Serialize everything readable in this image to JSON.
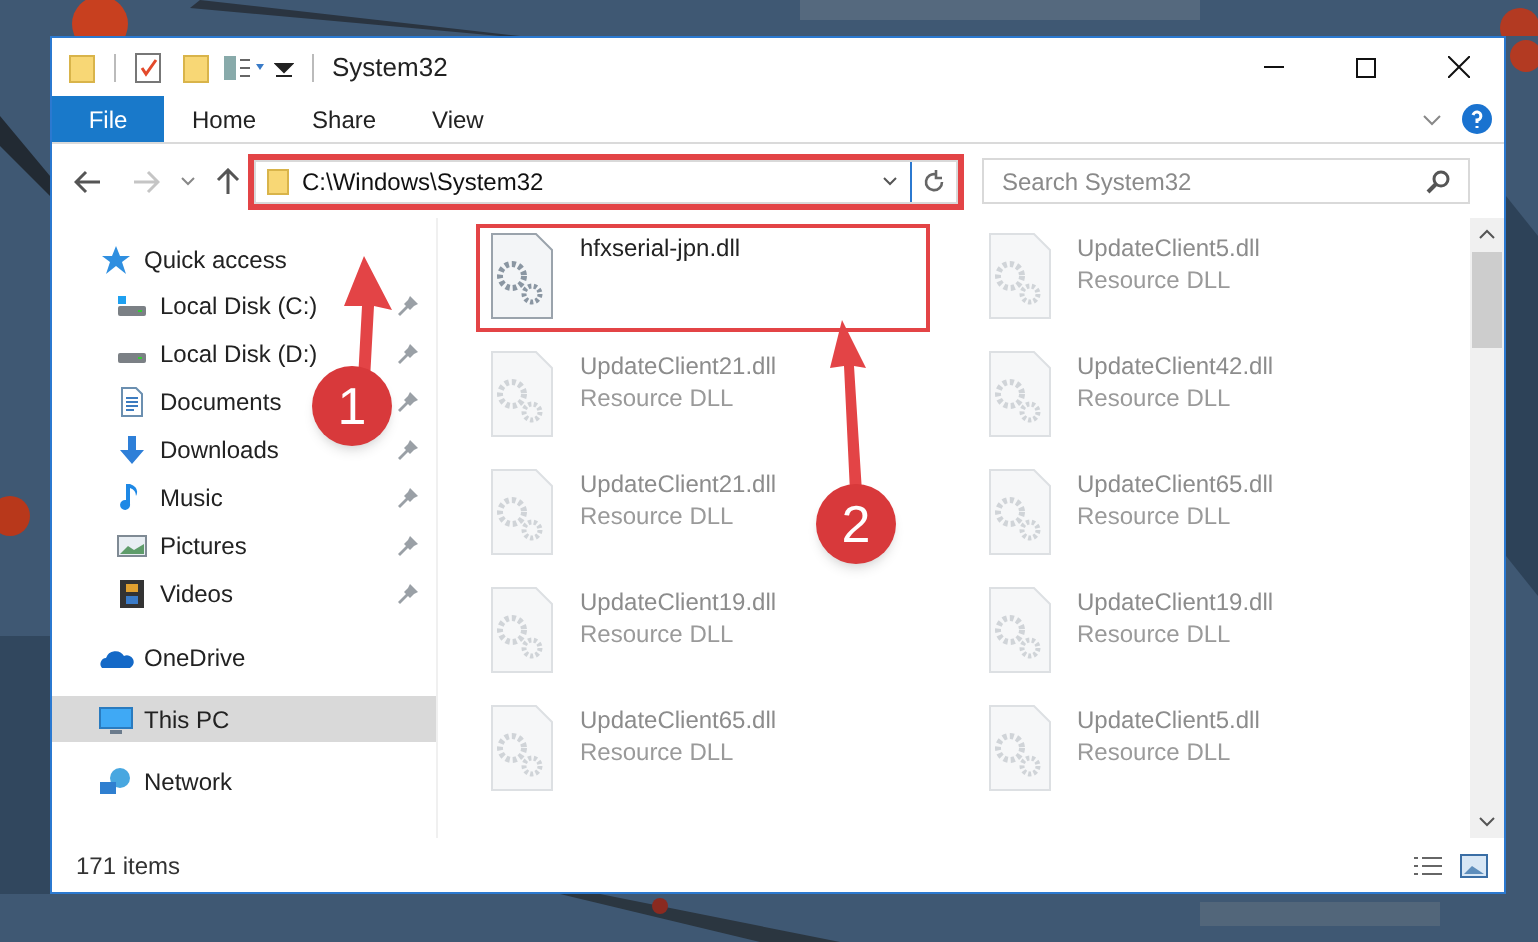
{
  "window": {
    "title": "System32"
  },
  "ribbon_tabs": [
    {
      "label": "File",
      "selected": true
    },
    {
      "label": "Home",
      "selected": false
    },
    {
      "label": "Share",
      "selected": false
    },
    {
      "label": "View",
      "selected": false
    }
  ],
  "address": {
    "value": "C:\\Windows\\System32",
    "highlighted": true
  },
  "search": {
    "placeholder": "Search System32"
  },
  "sidebar": {
    "items": [
      {
        "label": "Quick access",
        "selected": false,
        "children": [
          {
            "label": "Local Disk (C:)",
            "pinned": true
          },
          {
            "label": "Local Disk (D:)",
            "pinned": true
          },
          {
            "label": "Documents",
            "pinned": true
          },
          {
            "label": "Downloads",
            "pinned": true
          },
          {
            "label": "Music",
            "pinned": true
          },
          {
            "label": "Pictures",
            "pinned": true
          },
          {
            "label": "Videos",
            "pinned": true
          }
        ]
      },
      {
        "label": "OneDrive",
        "selected": false
      },
      {
        "label": "This PC",
        "selected": true
      },
      {
        "label": "Network",
        "selected": false
      }
    ]
  },
  "files": [
    {
      "name": "hfxserial-jpn.dll",
      "faded": false,
      "highlighted": true
    },
    {
      "name": "UpdateClient5.dll",
      "type": "Resource DLL",
      "faded": true,
      "highlighted": false
    },
    {
      "name": "UpdateClient21.dll",
      "type": "Resource DLL",
      "faded": true,
      "highlighted": false
    },
    {
      "name": "UpdateClient42.dll",
      "type": "Resource DLL",
      "faded": true,
      "highlighted": false
    },
    {
      "name": "UpdateClient21.dll",
      "type": "Resource DLL",
      "faded": true,
      "highlighted": false
    },
    {
      "name": "UpdateClient65.dll",
      "type": "Resource DLL",
      "faded": true,
      "highlighted": false
    },
    {
      "name": "UpdateClient19.dll",
      "type": "Resource DLL",
      "faded": true,
      "highlighted": false
    },
    {
      "name": "UpdateClient19.dll",
      "type": "Resource DLL",
      "faded": true,
      "highlighted": false
    },
    {
      "name": "UpdateClient65.dll",
      "type": "Resource DLL",
      "faded": true,
      "highlighted": false
    },
    {
      "name": "UpdateClient5.dll",
      "type": "Resource DLL",
      "faded": true,
      "highlighted": false
    }
  ],
  "status_bar": {
    "count": "171 items"
  },
  "annotations": [
    {
      "label": "1"
    },
    {
      "label": "2"
    }
  ]
}
